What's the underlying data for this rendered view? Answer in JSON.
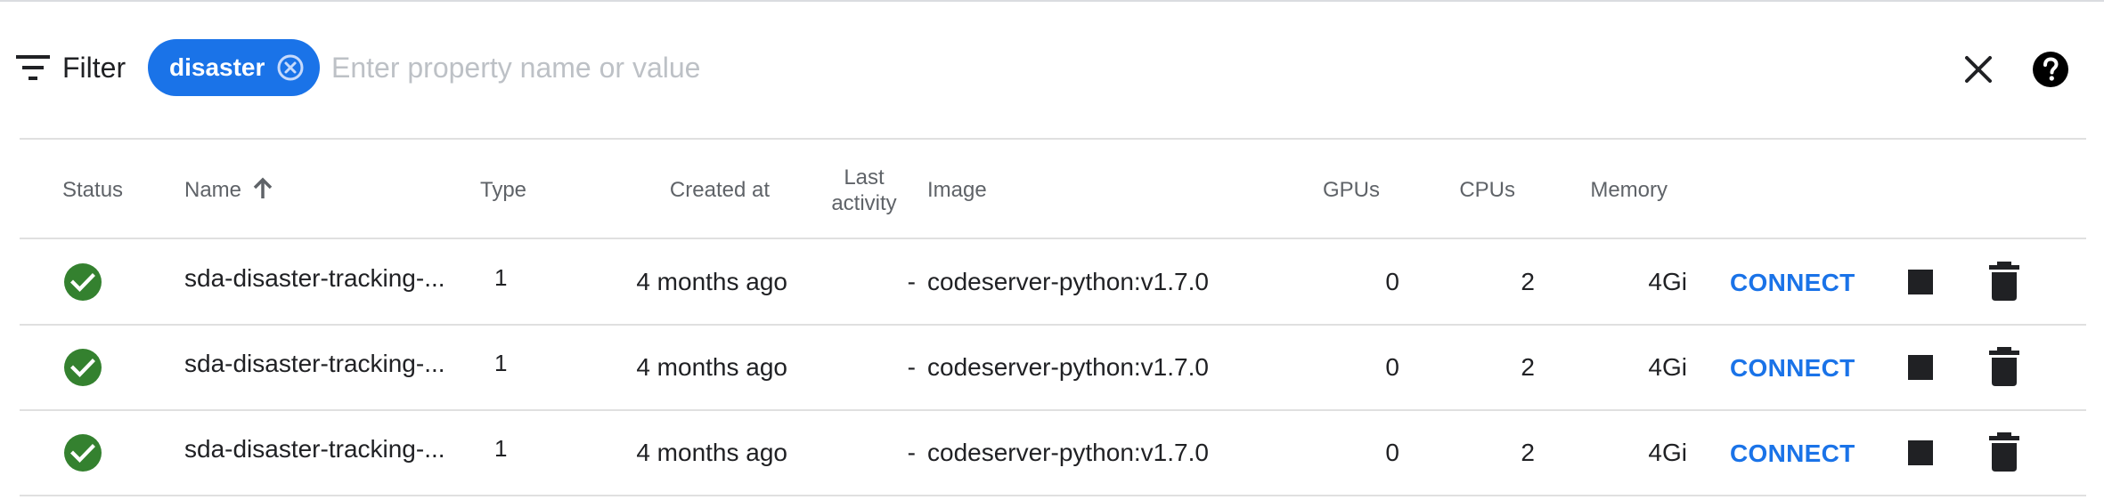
{
  "filter": {
    "label": "Filter",
    "chip_label": "disaster",
    "placeholder": "Enter property name or value"
  },
  "table": {
    "columns": {
      "status": "Status",
      "name": "Name",
      "type": "Type",
      "created_at": "Created at",
      "last_activity_line1": "Last",
      "last_activity_line2": "activity",
      "image": "Image",
      "gpus": "GPUs",
      "cpus": "CPUs",
      "memory": "Memory"
    },
    "sort": {
      "column": "Name",
      "direction": "ascending"
    },
    "rows": [
      {
        "status": "running",
        "name": "sda-disaster-tracking-...",
        "type": "1",
        "created_at": "4 months ago",
        "last_activity": "-",
        "image": "codeserver-python:v1.7.0",
        "gpus": "0",
        "cpus": "2",
        "memory": "4Gi",
        "connect": "CONNECT"
      },
      {
        "status": "running",
        "name": "sda-disaster-tracking-...",
        "type": "1",
        "created_at": "4 months ago",
        "last_activity": "-",
        "image": "codeserver-python:v1.7.0",
        "gpus": "0",
        "cpus": "2",
        "memory": "4Gi",
        "connect": "CONNECT"
      },
      {
        "status": "running",
        "name": "sda-disaster-tracking-...",
        "type": "1",
        "created_at": "4 months ago",
        "last_activity": "-",
        "image": "codeserver-python:v1.7.0",
        "gpus": "0",
        "cpus": "2",
        "memory": "4Gi",
        "connect": "CONNECT"
      }
    ]
  },
  "icons": {
    "filter": "filter-list-icon",
    "chip_close": "cancel-circle-icon",
    "clear": "close-icon",
    "help": "help-circle-icon",
    "sort": "arrow-upward-icon",
    "status": "check-circle-icon",
    "stop": "stop-icon",
    "delete": "trash-icon"
  },
  "colors": {
    "accent": "#1a73e8",
    "status_ok": "#34812f",
    "header_text": "#5f6368",
    "divider": "#e0e0e0"
  }
}
